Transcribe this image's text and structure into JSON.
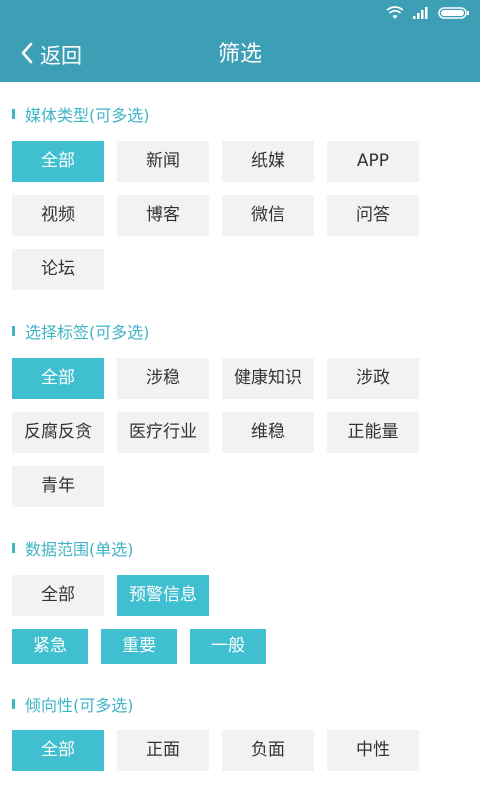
{
  "header": {
    "back_label": "返回",
    "title": "筛选"
  },
  "colors": {
    "header_bg": "#3d9fb6",
    "accent": "#3fbfcf",
    "chip_bg": "#f2f2f3"
  },
  "sections": [
    {
      "title": "媒体类型(可多选)",
      "options": [
        {
          "label": "全部",
          "selected": true
        },
        {
          "label": "新闻",
          "selected": false
        },
        {
          "label": "纸媒",
          "selected": false
        },
        {
          "label": "APP",
          "selected": false
        },
        {
          "label": "视频",
          "selected": false
        },
        {
          "label": "博客",
          "selected": false
        },
        {
          "label": "微信",
          "selected": false
        },
        {
          "label": "问答",
          "selected": false
        },
        {
          "label": "论坛",
          "selected": false
        }
      ]
    },
    {
      "title": "选择标签(可多选)",
      "options": [
        {
          "label": "全部",
          "selected": true
        },
        {
          "label": "涉稳",
          "selected": false
        },
        {
          "label": "健康知识",
          "selected": false
        },
        {
          "label": "涉政",
          "selected": false
        },
        {
          "label": "反腐反贪",
          "selected": false
        },
        {
          "label": "医疗行业",
          "selected": false
        },
        {
          "label": "维稳",
          "selected": false
        },
        {
          "label": "正能量",
          "selected": false
        },
        {
          "label": "青年",
          "selected": false
        }
      ]
    },
    {
      "title": "数据范围(单选)",
      "options": [
        {
          "label": "全部",
          "selected": false
        },
        {
          "label": "预警信息",
          "selected": true
        }
      ],
      "sub_options": [
        {
          "label": "紧急"
        },
        {
          "label": "重要"
        },
        {
          "label": "一般"
        }
      ]
    },
    {
      "title": "倾向性(可多选)",
      "options": [
        {
          "label": "全部",
          "selected": true
        },
        {
          "label": "正面",
          "selected": false
        },
        {
          "label": "负面",
          "selected": false
        },
        {
          "label": "中性",
          "selected": false
        }
      ]
    }
  ]
}
